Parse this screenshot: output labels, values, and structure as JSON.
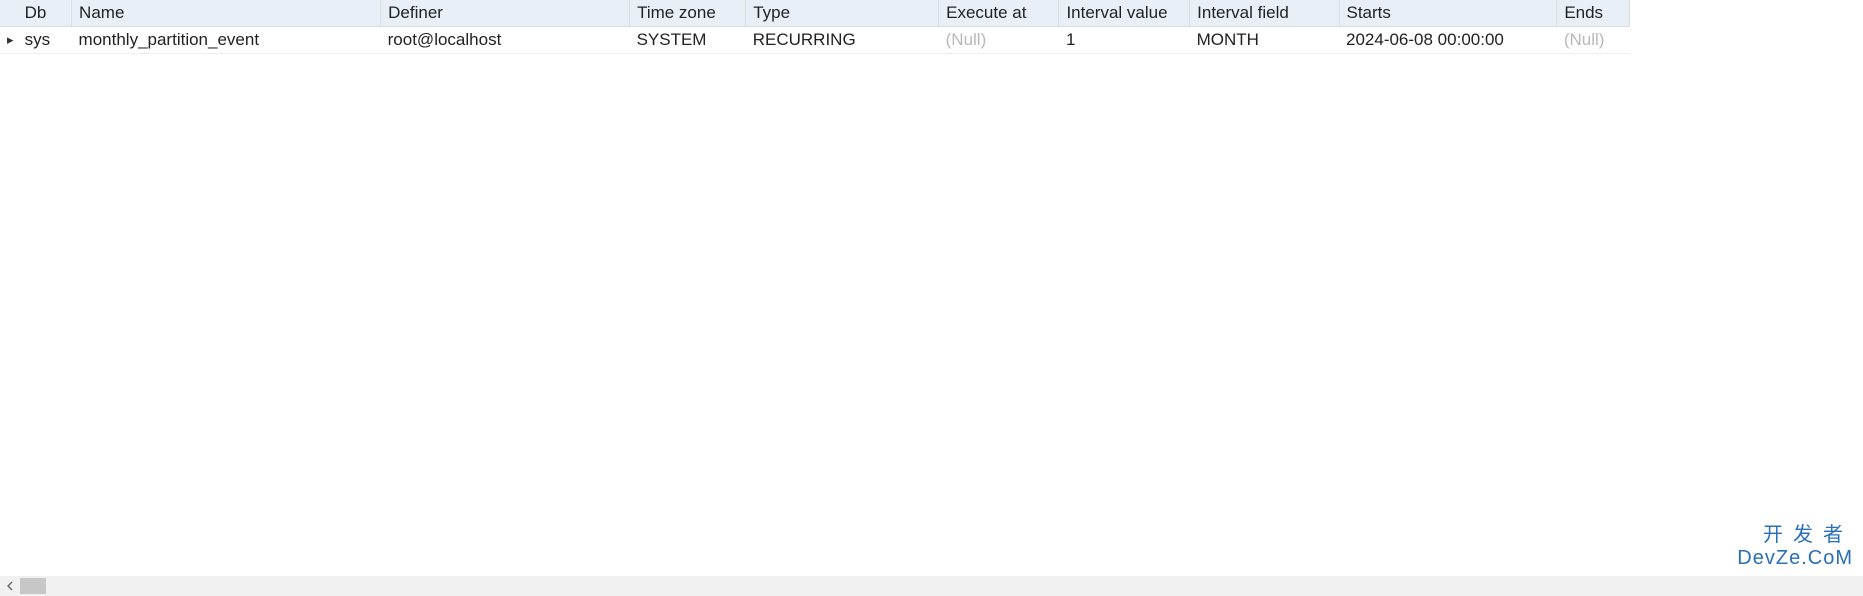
{
  "table": {
    "headers": {
      "db": "Db",
      "name": "Name",
      "definer": "Definer",
      "time_zone": "Time zone",
      "type": "Type",
      "execute_at": "Execute at",
      "interval_value": "Interval value",
      "interval_field": "Interval field",
      "starts": "Starts",
      "ends": "Ends"
    },
    "rows": [
      {
        "indicator": "▸",
        "db": "sys",
        "name": "monthly_partition_event",
        "definer": "root@localhost",
        "time_zone": "SYSTEM",
        "type": "RECURRING",
        "execute_at": "(Null)",
        "execute_at_null": true,
        "interval_value": "1",
        "interval_field": "MONTH",
        "starts": "2024-06-08 00:00:00",
        "ends": "(Null)",
        "ends_null": true
      }
    ]
  },
  "watermark": {
    "line1": "开发者",
    "line2": "DevZe.CoM"
  },
  "scroll": {
    "left_arrow": "◀"
  }
}
